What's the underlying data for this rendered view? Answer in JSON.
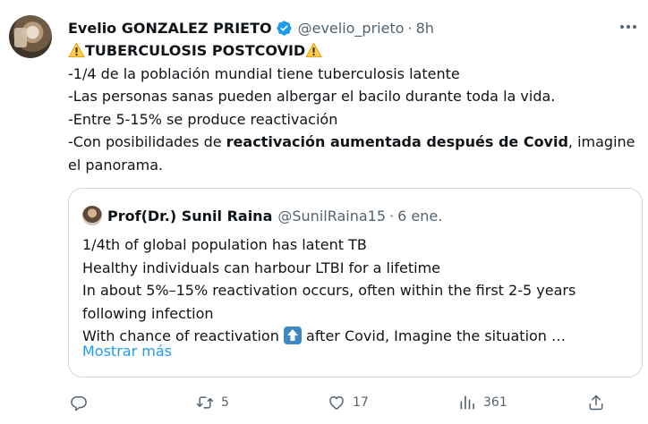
{
  "tweet": {
    "display_name": "Evelio GONZALEZ PRIETO",
    "handle": "@evelio_prieto",
    "separator": "·",
    "time": "8h",
    "title": "TUBERCULOSIS POSTCOVID",
    "lines": [
      "-1/4 de la población mundial tiene tuberculosis latente",
      "-Las personas sanas pueden albergar el bacilo durante toda la vida.",
      "-Entre 5-15% se produce reactivación"
    ],
    "last_line_prefix": "-Con posibilidades de ",
    "last_line_bold": "reactivación aumentada después de Covid",
    "last_line_suffix": ", imagine",
    "last_line_wrap": "el panorama."
  },
  "quoted": {
    "display_name": "Prof(Dr.) Sunil Raina",
    "handle": "@SunilRaina15",
    "separator": "·",
    "time": "6 ene.",
    "lines": [
      "1/4th of global population has latent TB",
      "Healthy individuals can harbour LTBI for a lifetime",
      "In about 5%–15% reactivation occurs, often within the first 2-5 years",
      "following infection"
    ],
    "last_line_prefix": "With chance of reactivation ",
    "last_line_suffix": " after Covid, Imagine the situation …",
    "show_more": "Mostrar más"
  },
  "actions": {
    "reply_count": "",
    "retweet_count": "5",
    "like_count": "17",
    "view_count": "361"
  },
  "colors": {
    "text": "#0f1419",
    "secondary": "#536471",
    "link": "#1d9bf0",
    "verified": "#1d9bf0",
    "border": "#cfd9de",
    "up_emoji": "#3b88c3"
  },
  "icons": [
    "verified-badge-icon",
    "warning-icon",
    "more-icon",
    "up-arrow-emoji",
    "reply-icon",
    "retweet-icon",
    "like-icon",
    "views-icon",
    "share-icon"
  ]
}
